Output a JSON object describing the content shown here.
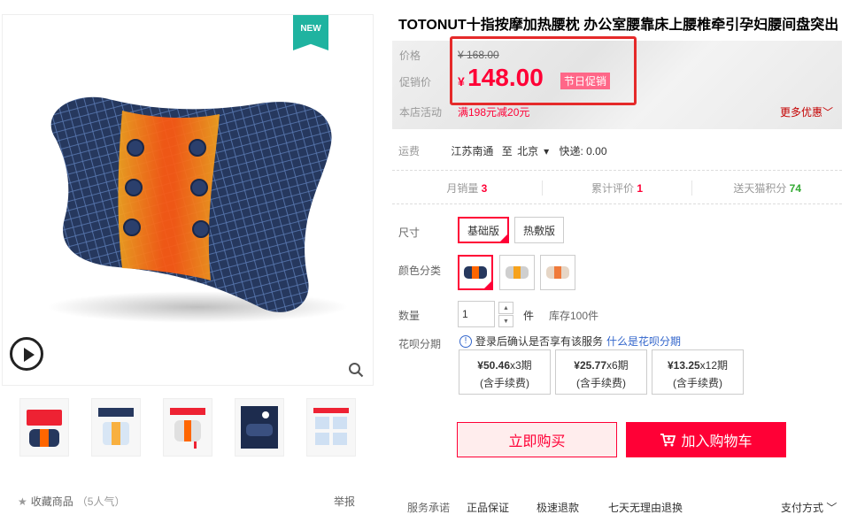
{
  "product": {
    "title": "TOTONUT十指按摩加热腰枕 办公室腰靠床上腰椎牵引孕妇腰间盘突出",
    "new_badge": "NEW"
  },
  "price": {
    "label_price": "价格",
    "original": "¥ 168.00",
    "label_promo": "促销价",
    "currency": "¥",
    "promo": "148.00",
    "promo_tag": "节日促销",
    "label_activity": "本店活动",
    "activity": "满198元减20元",
    "more": "更多优惠"
  },
  "shipping": {
    "label": "运费",
    "from": "江苏南通",
    "to_word": "至",
    "to": "北京",
    "express": "快递: 0.00"
  },
  "stats": {
    "monthly_label": "月销量",
    "monthly_value": "3",
    "reviews_label": "累计评价",
    "reviews_value": "1",
    "points_label": "送天猫积分",
    "points_value": "74"
  },
  "size": {
    "label": "尺寸",
    "options": [
      "基础版",
      "热敷版"
    ]
  },
  "color": {
    "label": "颜色分类"
  },
  "quantity": {
    "label": "数量",
    "value": "1",
    "unit": "件",
    "stock": "库存100件"
  },
  "huabei": {
    "label": "花呗分期",
    "notice": "登录后确认是否享有该服务",
    "link": "什么是花呗分期",
    "plans": [
      {
        "amount": "¥50.46",
        "periods": "x3期",
        "fee": "(含手续费)"
      },
      {
        "amount": "¥25.77",
        "periods": "x6期",
        "fee": "(含手续费)"
      },
      {
        "amount": "¥13.25",
        "periods": "x12期",
        "fee": "(含手续费)"
      }
    ]
  },
  "actions": {
    "buy": "立即购买",
    "cart": "加入购物车"
  },
  "footer": {
    "favorite": "收藏商品",
    "popularity": "（5人气）",
    "report": "举报",
    "promise_label": "服务承诺",
    "promise1": "正品保证",
    "promise2": "极速退款",
    "promise3": "七天无理由退换",
    "payment": "支付方式"
  },
  "colors": {
    "accent": "#ff0036",
    "highlight": "#e52a2a",
    "teal": "#1fb3a0"
  }
}
